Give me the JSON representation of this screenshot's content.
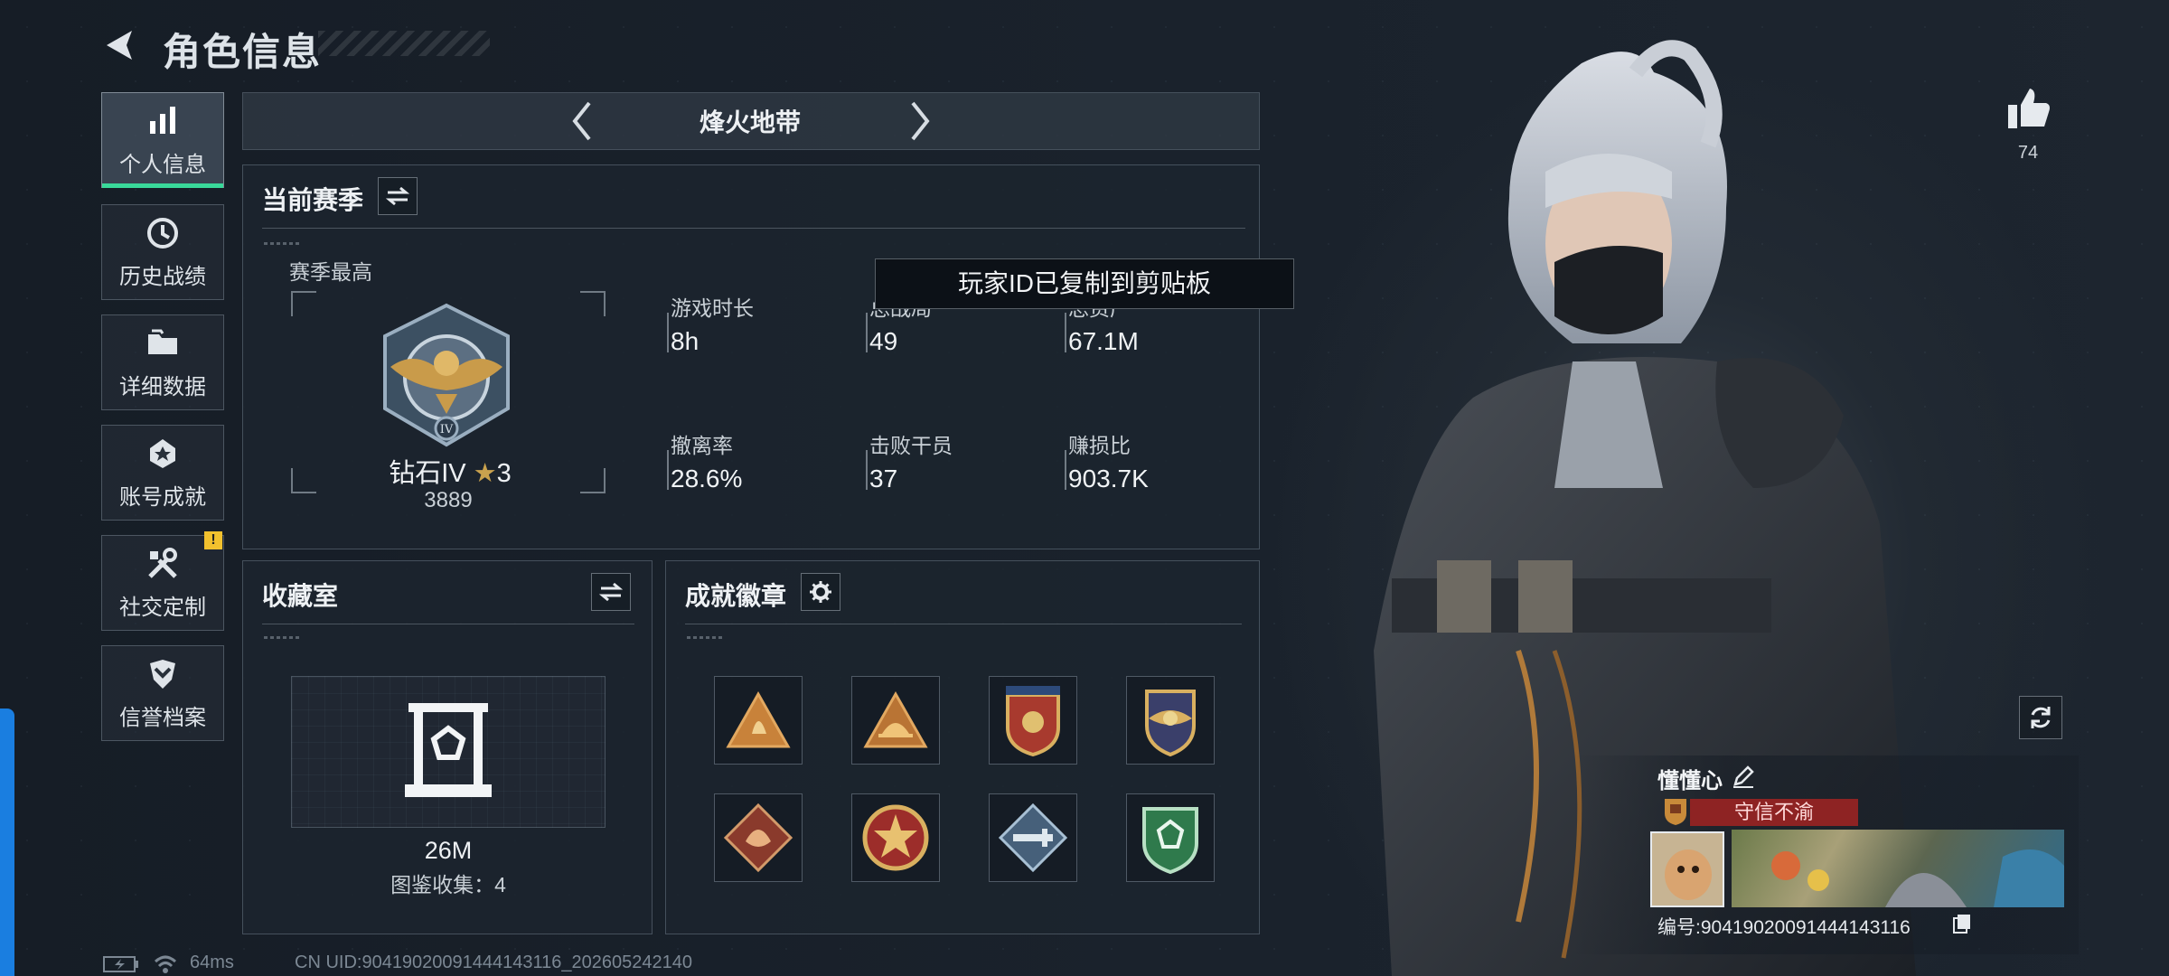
{
  "header": {
    "title": "角色信息"
  },
  "sidebar": {
    "items": [
      {
        "label": "个人信息",
        "icon": "bar-chart-icon",
        "active": true
      },
      {
        "label": "历史战绩",
        "icon": "history-clock-icon",
        "active": false
      },
      {
        "label": "详细数据",
        "icon": "folder-icon",
        "active": false
      },
      {
        "label": "账号成就",
        "icon": "achievement-star-icon",
        "active": false
      },
      {
        "label": "社交定制",
        "icon": "tools-icon",
        "active": false,
        "badge": "!"
      },
      {
        "label": "信誉档案",
        "icon": "shield-chevron-icon",
        "active": false
      }
    ]
  },
  "mode_bar": {
    "title": "烽火地带"
  },
  "season": {
    "title": "当前赛季",
    "best_label": "赛季最高",
    "rank_name": "钻石IV",
    "rank_stars": "3",
    "rank_points": "3889",
    "stats": [
      {
        "label": "游戏时长",
        "value": "8h"
      },
      {
        "label": "总战局",
        "value": "49"
      },
      {
        "label": "总资产",
        "value": "67.1M"
      },
      {
        "label": "撤离率",
        "value": "28.6%"
      },
      {
        "label": "击败干员",
        "value": "37"
      },
      {
        "label": "赚损比",
        "value": "903.7K"
      }
    ]
  },
  "toast": {
    "text": "玩家ID已复制到剪贴板"
  },
  "collection": {
    "title": "收藏室",
    "value": "26M",
    "catalog": "图鉴收集：4"
  },
  "achievements": {
    "title": "成就徽章",
    "badges": [
      "flame-triangle-badge-icon",
      "hat-triangle-badge-icon",
      "star-crest-badge-icon",
      "wing-crest-badge-icon",
      "dragon-diamond-badge-icon",
      "star-circle-badge-icon",
      "rifle-diamond-badge-icon",
      "green-shield-badge-icon"
    ]
  },
  "footer": {
    "ping": "64ms",
    "uid": "CN UID:90419020091444143116_202605242140"
  },
  "player": {
    "name": "懂懂心",
    "title_tag": "守信不渝",
    "id_text": "编号:90419020091444143116",
    "likes": "74"
  },
  "colors": {
    "active_tab_accent": "#39d99a",
    "title_tag_bg": "#8e2323",
    "notice_badge": "#f2c12e"
  }
}
